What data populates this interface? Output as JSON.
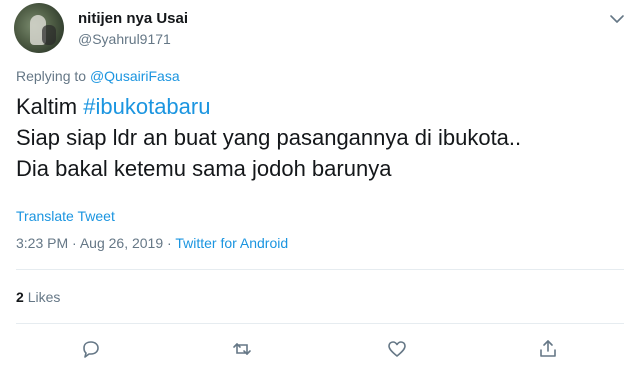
{
  "author": {
    "display_name": "nitijen nya Usai",
    "handle": "@Syahrul9171"
  },
  "reply": {
    "prefix": "Replying to",
    "mention": "@QusairiFasa"
  },
  "tweet": {
    "line1_prefix": "Kaltim ",
    "hashtag": "#ibukotabaru",
    "line2": "Siap siap ldr an buat yang pasangannya di ibukota..",
    "line3": "Dia bakal ketemu sama jodoh barunya"
  },
  "translate_label": "Translate Tweet",
  "meta": {
    "time": "3:23 PM",
    "separator": "·",
    "date": "Aug 26, 2019",
    "source": "Twitter for Android"
  },
  "stats": {
    "likes_count": "2",
    "likes_label": "Likes"
  },
  "actions": [
    "reply-icon",
    "retweet-icon",
    "like-icon",
    "share-icon"
  ],
  "colors": {
    "link": "#1b95e0",
    "secondary": "#657786",
    "text": "#14171a",
    "divider": "#e6ecf0"
  }
}
